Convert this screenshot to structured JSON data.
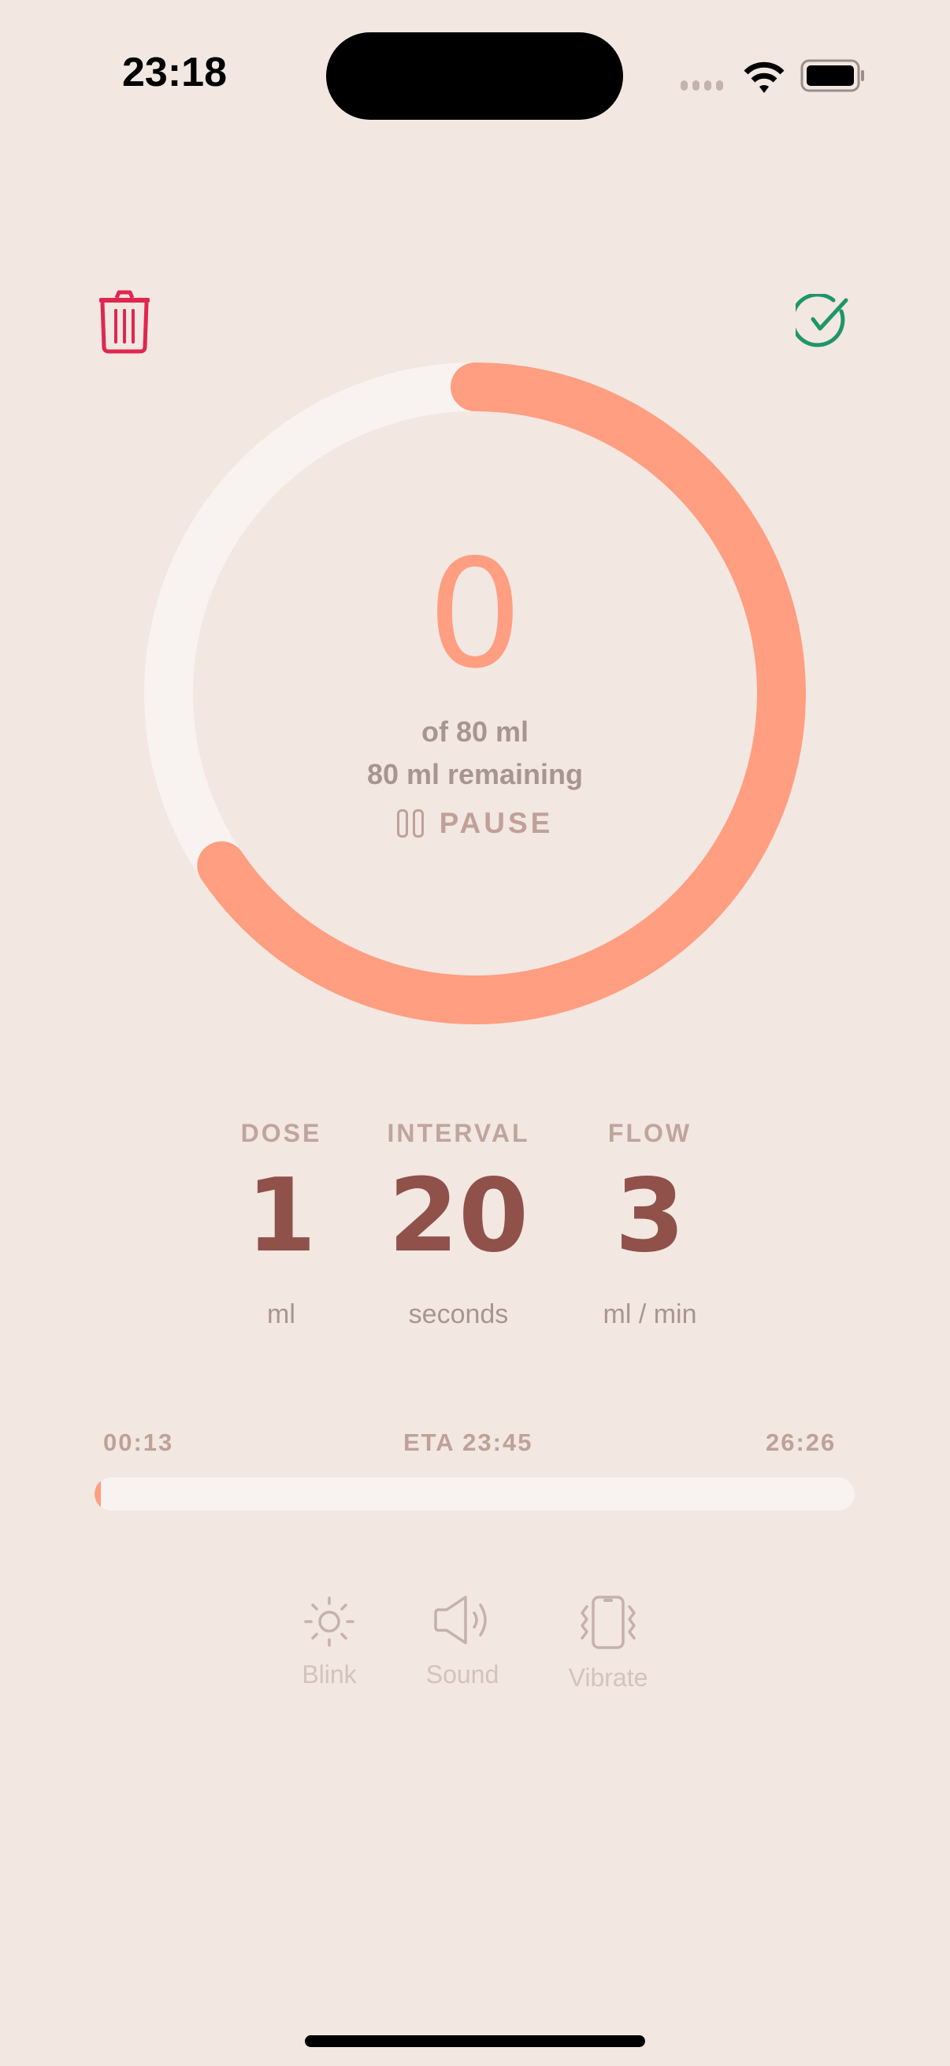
{
  "status_bar": {
    "time": "23:18",
    "icons": [
      "cellular-signal-icon",
      "wifi-icon",
      "battery-icon"
    ]
  },
  "toolbar": {
    "delete_icon": "trash-icon",
    "confirm_icon": "checkmark-circle-icon"
  },
  "progress_ring": {
    "delivered_value": "0",
    "total_label": "of 80 ml",
    "remaining_label": "80 ml remaining",
    "pause_label": "PAUSE",
    "ring_fraction": 0.655,
    "ring_color": "#ff9e80",
    "track_color": "#f8f3f0"
  },
  "stats": [
    {
      "label": "DOSE",
      "value": "1",
      "unit": "ml"
    },
    {
      "label": "INTERVAL",
      "value": "20",
      "unit": "seconds"
    },
    {
      "label": "FLOW",
      "value": "3",
      "unit": "ml / min"
    }
  ],
  "timeline": {
    "elapsed": "00:13",
    "eta": "ETA 23:45",
    "remaining": "26:26",
    "progress_fraction": 0.008
  },
  "alerts": [
    {
      "label": "Blink",
      "icon": "sun-icon"
    },
    {
      "label": "Sound",
      "icon": "speaker-icon"
    },
    {
      "label": "Vibrate",
      "icon": "phone-vibrate-icon"
    }
  ],
  "colors": {
    "background": "#f2e7e1",
    "accent": "#ff9e80",
    "delete": "#e0264f",
    "confirm": "#1e9668",
    "stat_value": "#8f514a"
  }
}
